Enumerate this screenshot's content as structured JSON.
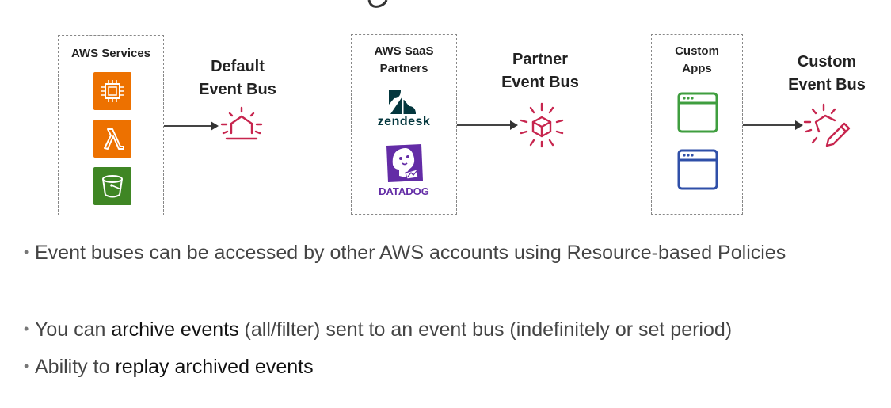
{
  "groups": [
    {
      "title_lines": [
        "AWS Services"
      ],
      "bus_lines": [
        "Default",
        "Event Bus"
      ]
    },
    {
      "title_lines": [
        "AWS SaaS",
        "Partners"
      ],
      "bus_lines": [
        "Partner",
        "Event Bus"
      ],
      "logos": {
        "zendesk": "zendesk",
        "datadog": "DATADOG"
      }
    },
    {
      "title_lines": [
        "Custom",
        "Apps"
      ],
      "bus_lines": [
        "Custom",
        "Event Bus"
      ]
    }
  ],
  "bullets": [
    {
      "before": "Event buses can be accessed by other AWS accounts using Resource-based Policies",
      "strong": "",
      "after": ""
    },
    {
      "before": "You can ",
      "strong": "archive events",
      "after": " (all/filter) sent to an event bus (indefinitely or set period)"
    },
    {
      "before": "Ability to ",
      "strong": "replay archived events",
      "after": ""
    }
  ],
  "colors": {
    "ec2": "#ED7100",
    "lambda": "#ED7100",
    "s3": "#3F8624",
    "eventbus": "#C7254E",
    "app_green": "#3F9E3F",
    "app_blue": "#2F4FA8",
    "zendesk": "#03363D",
    "datadog": "#632CA6"
  },
  "icons": [
    "ec2-icon",
    "lambda-icon",
    "s3-bucket-icon",
    "zendesk-logo",
    "datadog-logo",
    "app-window-icon",
    "event-bus-icon",
    "custom-event-bus-icon"
  ]
}
